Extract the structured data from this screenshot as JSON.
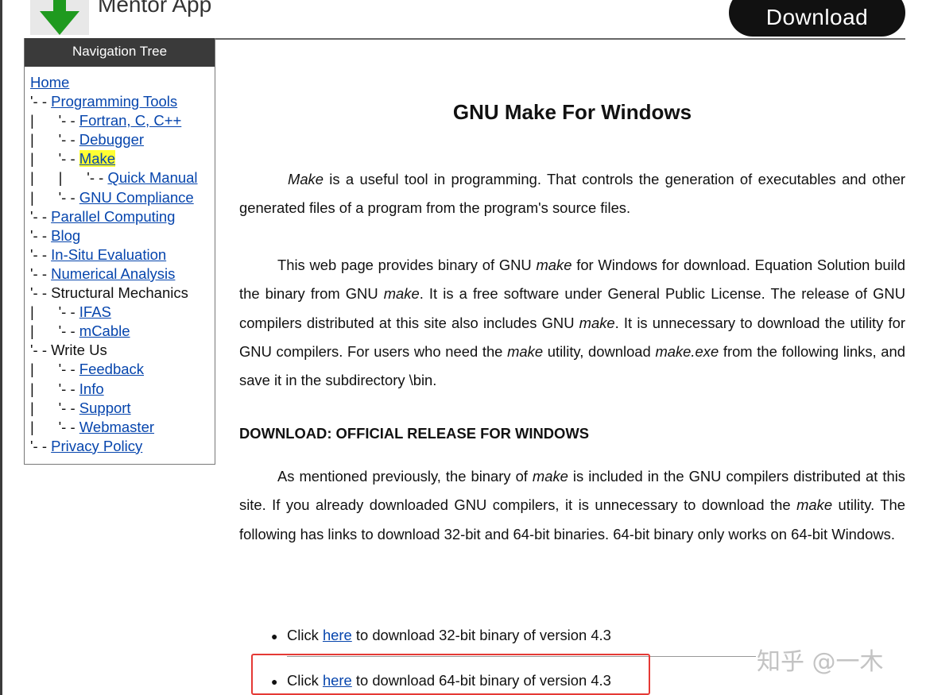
{
  "header": {
    "app_name": "Mentor App",
    "download_label": "Download"
  },
  "nav": {
    "heading": "Navigation Tree",
    "items": [
      {
        "prefix": "",
        "label": "Home",
        "type": "link"
      },
      {
        "prefix": "'- - ",
        "label": "Programming Tools",
        "type": "link"
      },
      {
        "prefix": "|      '- - ",
        "label": "Fortran, C, C++",
        "type": "link"
      },
      {
        "prefix": "|      '- - ",
        "label": "Debugger",
        "type": "link"
      },
      {
        "prefix": "|      '- - ",
        "label": "Make",
        "type": "current"
      },
      {
        "prefix": "|      |      '- - ",
        "label": "Quick Manual",
        "type": "link"
      },
      {
        "prefix": "|      '- - ",
        "label": "GNU Compliance",
        "type": "link"
      },
      {
        "prefix": "'- - ",
        "label": "Parallel Computing",
        "type": "link"
      },
      {
        "prefix": "'- - ",
        "label": "Blog",
        "type": "link"
      },
      {
        "prefix": "'- - ",
        "label": "In-Situ Evaluation",
        "type": "link"
      },
      {
        "prefix": "'- - ",
        "label": "Numerical Analysis",
        "type": "link"
      },
      {
        "prefix": "'- - ",
        "label": "Structural Mechanics",
        "type": "plain"
      },
      {
        "prefix": "|      '- - ",
        "label": "IFAS",
        "type": "link"
      },
      {
        "prefix": "|      '- - ",
        "label": "mCable",
        "type": "link"
      },
      {
        "prefix": "'- - ",
        "label": "Write Us",
        "type": "plain"
      },
      {
        "prefix": "|      '- - ",
        "label": "Feedback",
        "type": "link"
      },
      {
        "prefix": "|      '- - ",
        "label": "Info",
        "type": "link"
      },
      {
        "prefix": "|      '- - ",
        "label": "Support",
        "type": "link"
      },
      {
        "prefix": "|      '- - ",
        "label": "Webmaster",
        "type": "link"
      },
      {
        "prefix": "'- - ",
        "label": "Privacy Policy",
        "type": "link"
      }
    ]
  },
  "main": {
    "title": "GNU Make For Windows",
    "p1": {
      "em": "Make",
      "rest": " is a useful tool in programming. That controls the generation of executables and other generated files of a program from the program's source files."
    },
    "p2": {
      "t1": "This web page provides binary of GNU ",
      "e1": "make",
      "t2": " for Windows for download. Equation Solution build the binary from GNU ",
      "e2": "make",
      "t3": ". It is a free software under General Public License. The release of GNU compilers distributed at this site also includes GNU ",
      "e3": "make",
      "t4": ". It is unnecessary to download the utility for GNU compilers. For users who need the ",
      "e4": "make",
      "t5": " utility, download ",
      "e5": "make.exe",
      "t6": " from the following links, and save it in the subdirectory \\bin."
    },
    "section_heading": "DOWNLOAD: OFFICIAL RELEASE FOR WINDOWS",
    "p3": {
      "t1": "As mentioned previously, the binary of ",
      "e1": "make",
      "t2": " is included in the GNU compilers distributed at this site. If you already downloaded GNU compilers, it is unnecessary to download the ",
      "e2": "make",
      "t3": " utility. The following has links to download 32-bit and 64-bit binaries. 64-bit binary only works on 64-bit Windows."
    },
    "downloads": [
      {
        "before": "Click ",
        "link": "here",
        "after": " to download 32-bit binary of version 4.3"
      },
      {
        "before": "Click ",
        "link": "here",
        "after": " to download 64-bit binary of version 4.3"
      }
    ]
  },
  "watermark": "知乎 @一木",
  "colors": {
    "link": "#0645ad",
    "nav_header_bg": "#3a3a3a",
    "current_highlight": "#ffff33",
    "annotation_box": "#e53935",
    "logo_arrow": "#1f9a1f"
  }
}
